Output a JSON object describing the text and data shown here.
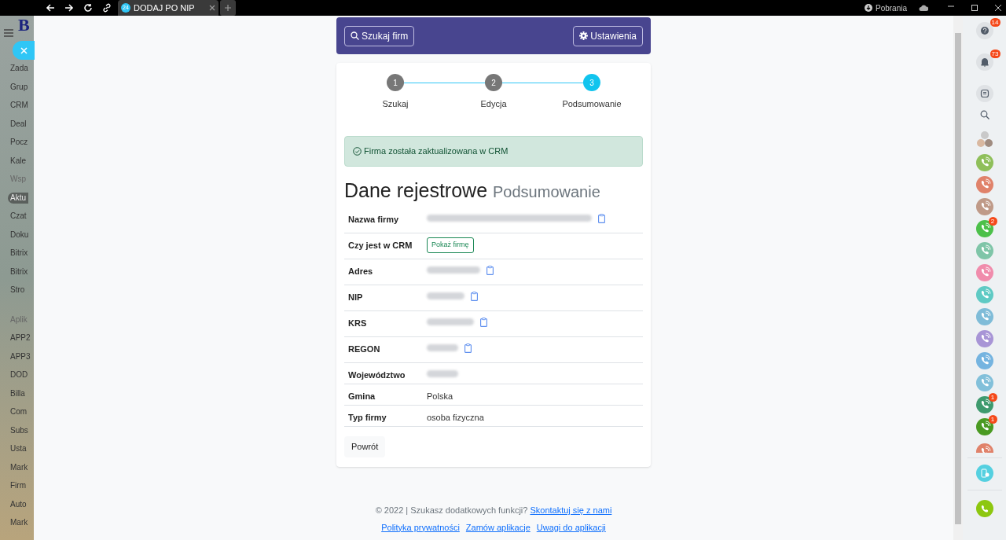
{
  "browser": {
    "tab_badge": "24",
    "tab_title": "DODAJ PO NIP",
    "downloads": "Pobrania"
  },
  "sidebar": {
    "logo": "B",
    "items": [
      {
        "label": "Zada",
        "kind": "item",
        "selected": false
      },
      {
        "label": "Grup",
        "kind": "item",
        "selected": false
      },
      {
        "label": "CRM",
        "kind": "item",
        "selected": false
      },
      {
        "label": "Deal",
        "kind": "item",
        "selected": false
      },
      {
        "label": "Pocz",
        "kind": "item",
        "selected": false
      },
      {
        "label": "Kale",
        "kind": "item",
        "selected": false
      },
      {
        "label": "Wsp",
        "kind": "heading",
        "selected": false
      },
      {
        "label": "Aktu",
        "kind": "item",
        "selected": true
      },
      {
        "label": "Czat",
        "kind": "item",
        "selected": false
      },
      {
        "label": "Doku",
        "kind": "item",
        "selected": false
      },
      {
        "label": "Bitrix",
        "kind": "item",
        "selected": false
      },
      {
        "label": "Bitrix",
        "kind": "item",
        "selected": false
      },
      {
        "label": "Stro",
        "kind": "item",
        "selected": false
      },
      {
        "label": "Aplik",
        "kind": "heading",
        "selected": false
      },
      {
        "label": "APP2",
        "kind": "item",
        "selected": false
      },
      {
        "label": "APP3",
        "kind": "item",
        "selected": false
      },
      {
        "label": "DOD",
        "kind": "item",
        "selected": false
      },
      {
        "label": "Billa",
        "kind": "item",
        "selected": false
      },
      {
        "label": "Com",
        "kind": "item",
        "selected": false
      },
      {
        "label": "Subs",
        "kind": "item",
        "selected": false
      },
      {
        "label": "Usta",
        "kind": "item",
        "selected": false
      },
      {
        "label": "Mark",
        "kind": "item",
        "selected": false
      },
      {
        "label": "Firm",
        "kind": "item",
        "selected": false
      },
      {
        "label": "Auto",
        "kind": "item",
        "selected": false
      },
      {
        "label": "Mark",
        "kind": "item",
        "selected": false
      }
    ]
  },
  "header": {
    "search_button": "Szukaj firm",
    "settings_button": "Ustawienia"
  },
  "steps": [
    {
      "number": "1",
      "label": "Szukaj",
      "selected": false
    },
    {
      "number": "2",
      "label": "Edycja",
      "selected": false
    },
    {
      "number": "3",
      "label": "Podsumowanie",
      "selected": true
    }
  ],
  "alert": "Firma została zaktualizowana w CRM",
  "heading": {
    "title": "Dane rejestrowe",
    "subtitle": "Podsumowanie"
  },
  "rows": [
    {
      "label": "Nazwa firmy",
      "kind": "redacted",
      "copy": true
    },
    {
      "label": "Czy jest w CRM",
      "kind": "button",
      "value": "Pokaż firmę",
      "copy": false
    },
    {
      "label": "Adres",
      "kind": "redacted",
      "copy": true
    },
    {
      "label": "NIP",
      "kind": "redacted",
      "copy": true
    },
    {
      "label": "KRS",
      "kind": "redacted",
      "copy": true
    },
    {
      "label": "REGON",
      "kind": "redacted",
      "copy": true
    },
    {
      "label": "Województwo",
      "kind": "redacted",
      "copy": false
    },
    {
      "label": "Gmina",
      "kind": "text",
      "value": "Polska",
      "copy": false
    },
    {
      "label": "Typ firmy",
      "kind": "text",
      "value": "osoba fizyczna",
      "copy": false
    }
  ],
  "back_button": "Powrót",
  "footer": {
    "text": "© 2022 | Szukasz dodatkowych funkcji?",
    "contact_link": "Skontaktuj się z nami",
    "links": [
      "Polityka prywatności",
      "Zamów aplikacje",
      "Uwagi do aplikacji"
    ]
  },
  "right_panel": {
    "top": [
      {
        "kind": "help",
        "badge": "14"
      },
      {
        "kind": "bell",
        "badge": "73"
      },
      {
        "kind": "chat"
      }
    ],
    "calls": [
      {
        "color": "#8fbf5a"
      },
      {
        "color": "#e0826a"
      },
      {
        "color": "#bf9a88"
      },
      {
        "color": "#4cc04a",
        "badge": "2"
      },
      {
        "color": "#7fc5a8"
      },
      {
        "color": "#f08cac"
      },
      {
        "color": "#5fcac4"
      },
      {
        "color": "#7fbcd8"
      },
      {
        "color": "#a895d6"
      },
      {
        "color": "#75b4e0"
      },
      {
        "color": "#82c0da"
      },
      {
        "color": "#3e9a6e",
        "badge": "1"
      },
      {
        "color": "#4a9a22",
        "badge": "1"
      },
      {
        "color": "#e0826a"
      }
    ]
  }
}
